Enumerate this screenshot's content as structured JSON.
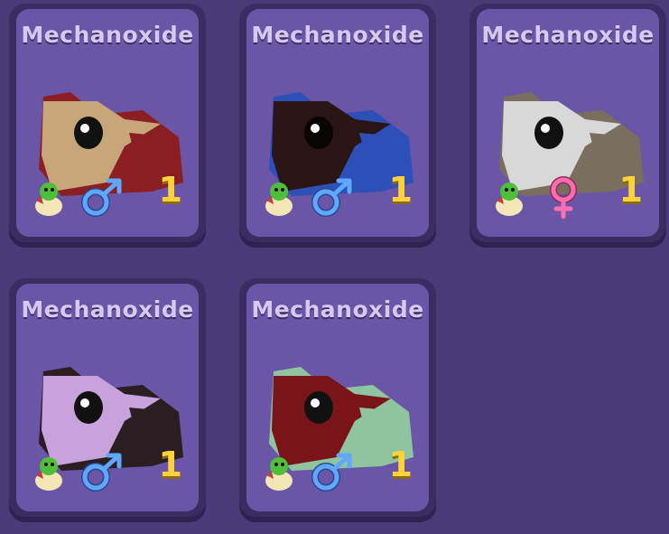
{
  "cards": [
    {
      "name": "Mechanoxide",
      "level": "1",
      "gender": "male",
      "gender_icon": "male-symbol-icon",
      "colors": {
        "face": "#c7a77a",
        "body": "#8a1e22",
        "ear": "#6e1518"
      }
    },
    {
      "name": "Mechanoxide",
      "level": "1",
      "gender": "male",
      "gender_icon": "male-symbol-icon",
      "colors": {
        "face": "#2a1414",
        "body": "#2c4fb8",
        "ear": "#1f3d98"
      }
    },
    {
      "name": "Mechanoxide",
      "level": "1",
      "gender": "female",
      "gender_icon": "female-symbol-icon",
      "colors": {
        "face": "#d8d8d8",
        "body": "#7a6e5e",
        "ear": "#5f5547"
      }
    },
    {
      "name": "Mechanoxide",
      "level": "1",
      "gender": "male",
      "gender_icon": "male-symbol-icon",
      "colors": {
        "face": "#c7a2dc",
        "body": "#2a1e22",
        "ear": "#2a1e22"
      }
    },
    {
      "name": "Mechanoxide",
      "level": "1",
      "gender": "male",
      "gender_icon": "male-symbol-icon",
      "colors": {
        "face": "#7a1418",
        "body": "#8ec4a0",
        "ear": "#75ae8a"
      }
    }
  ],
  "icons": {
    "egg": "baby-dragon-egg-icon"
  },
  "palette": {
    "background": "#4b3a78",
    "card": "#6a55a6",
    "level_text": "#ffd23a",
    "male": "#5fa8ff",
    "female": "#ff6fb0"
  }
}
